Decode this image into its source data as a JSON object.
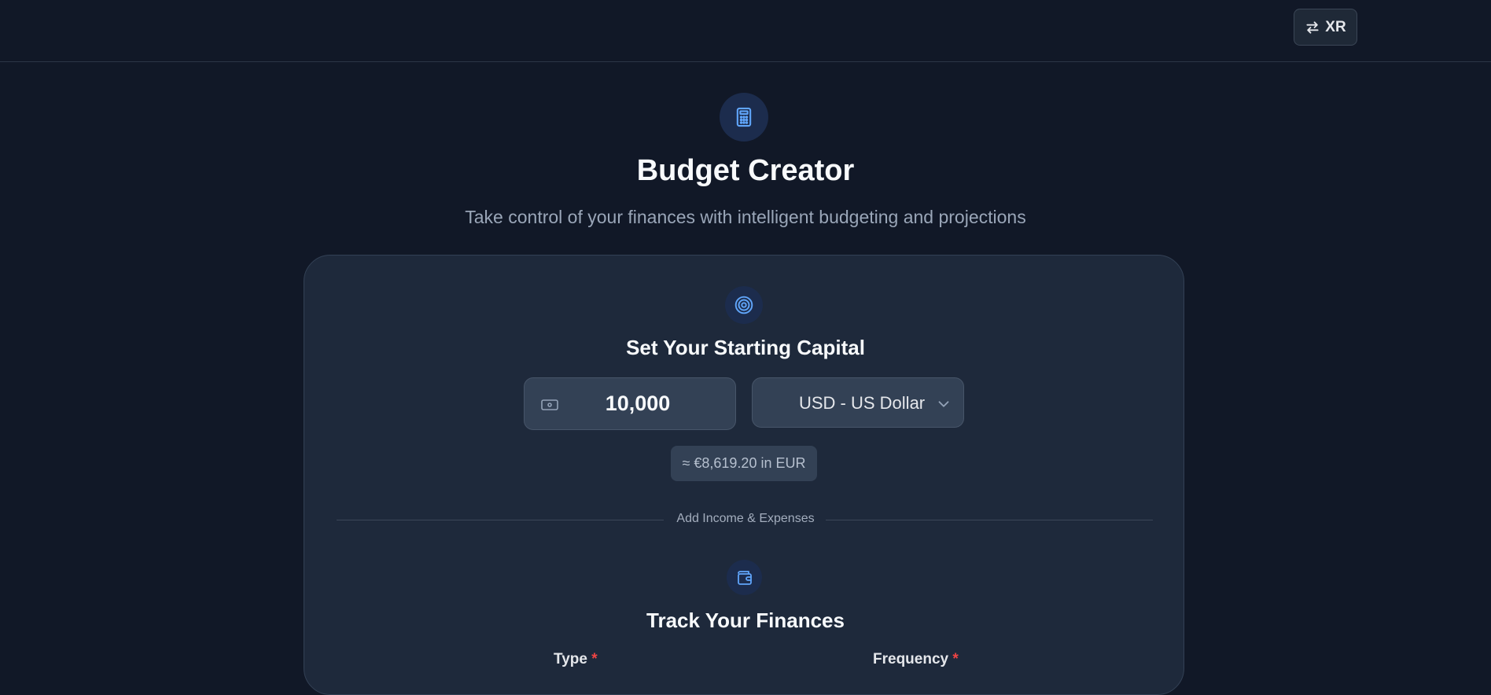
{
  "header": {
    "xr_button_label": "XR"
  },
  "hero": {
    "icon": "calculator-icon",
    "title": "Budget Creator",
    "subtitle": "Take control of your finances with intelligent budgeting and projections"
  },
  "capital": {
    "icon": "target-icon",
    "title": "Set Your Starting Capital",
    "amount_value": "10,000",
    "currency_selected": "USD - US Dollar",
    "conversion_text": "≈ €8,619.20 in EUR"
  },
  "divider": {
    "label": "Add Income & Expenses"
  },
  "track": {
    "icon": "wallet-icon",
    "title": "Track Your Finances",
    "type_label": "Type",
    "frequency_label": "Frequency",
    "required_marker": "*"
  },
  "colors": {
    "background": "#111827",
    "card": "#1e293b",
    "accent": "#3b82f6",
    "required": "#ef4444"
  }
}
